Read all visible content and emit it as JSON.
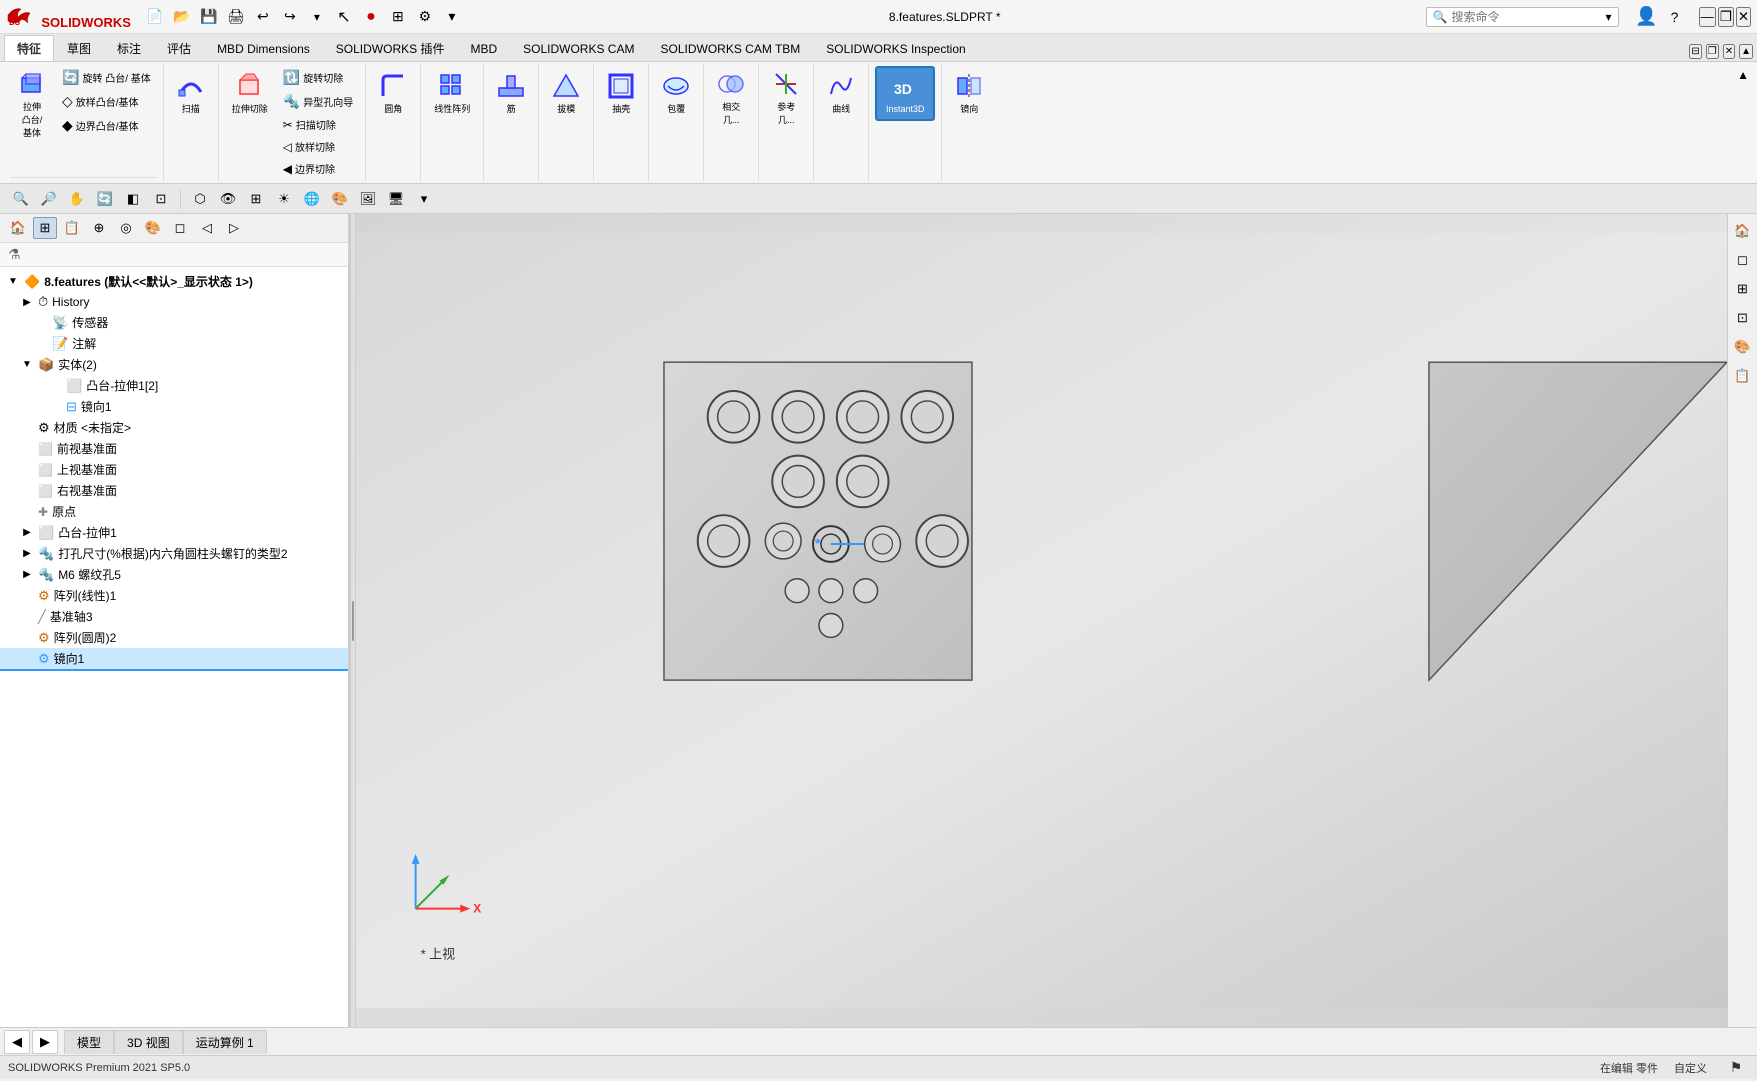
{
  "app": {
    "name": "SOLIDWORKS",
    "title": "8.features.SLDPRT *",
    "version": "SOLIDWORKS Premium 2021 SP5.0",
    "status_left": "在编辑 零件",
    "status_right": "自定义"
  },
  "titlebar": {
    "search_placeholder": "搜索命令",
    "win_min": "—",
    "win_restore": "❐",
    "win_close": "✕"
  },
  "ribbon_tabs": [
    {
      "label": "特征",
      "active": true
    },
    {
      "label": "草图"
    },
    {
      "label": "标注"
    },
    {
      "label": "评估"
    },
    {
      "label": "MBD Dimensions"
    },
    {
      "label": "SOLIDWORKS 插件"
    },
    {
      "label": "MBD"
    },
    {
      "label": "SOLIDWORKS CAM"
    },
    {
      "label": "SOLIDWORKS CAM TBM"
    },
    {
      "label": "SOLIDWORKS Inspection"
    }
  ],
  "ribbon_buttons": [
    {
      "label": "拉伸\n凸台/\n基体",
      "icon": "⬜"
    },
    {
      "label": "旋转\n凸台/\n基体",
      "icon": "🔄"
    },
    {
      "label": "放样凸台/基体",
      "icon": "📐"
    },
    {
      "label": "边界凸台/基体",
      "icon": "🔷"
    },
    {
      "label": "扫描",
      "icon": "〰"
    },
    {
      "label": "拉伸切除",
      "icon": "✂"
    },
    {
      "label": "旋转切除",
      "icon": "🔃"
    },
    {
      "label": "异型孔向导",
      "icon": "🔩"
    },
    {
      "label": "扫描切除",
      "icon": "✂"
    },
    {
      "label": "放样切除",
      "icon": "📐"
    },
    {
      "label": "边界切除",
      "icon": "🔶"
    },
    {
      "label": "圆角",
      "icon": "◟"
    },
    {
      "label": "线性阵列",
      "icon": "⠿"
    },
    {
      "label": "筋",
      "icon": "⊞"
    },
    {
      "label": "拔模",
      "icon": "◁"
    },
    {
      "label": "抽壳",
      "icon": "⬡"
    },
    {
      "label": "包覆",
      "icon": "🎁"
    },
    {
      "label": "相交\n几...",
      "icon": "⊗"
    },
    {
      "label": "参考\n几...",
      "icon": "📏"
    },
    {
      "label": "曲线",
      "icon": "〜"
    },
    {
      "label": "Instant3D",
      "icon": "3D",
      "highlighted": true
    },
    {
      "label": "镜向",
      "icon": "⊟"
    }
  ],
  "sidebar": {
    "tree_title": "8.features  (默认<<默认>_显示状态 1>)",
    "items": [
      {
        "id": "history",
        "label": "History",
        "icon": "⏱",
        "level": 1,
        "expandable": true
      },
      {
        "id": "sensor",
        "label": "传感器",
        "icon": "📡",
        "level": 1,
        "expandable": false
      },
      {
        "id": "annotation",
        "label": "注解",
        "icon": "📝",
        "level": 1,
        "expandable": false
      },
      {
        "id": "solid",
        "label": "实体(2)",
        "icon": "📦",
        "level": 1,
        "expandable": true
      },
      {
        "id": "boss1",
        "label": "凸台-拉伸1[2]",
        "icon": "⬜",
        "level": 2,
        "expandable": false
      },
      {
        "id": "mirror1-child",
        "label": "镜向1",
        "icon": "⊟",
        "level": 2,
        "expandable": false
      },
      {
        "id": "material",
        "label": "材质 <未指定>",
        "icon": "🔧",
        "level": 1,
        "expandable": false
      },
      {
        "id": "front-plane",
        "label": "前视基准面",
        "icon": "⬜",
        "level": 1,
        "expandable": false
      },
      {
        "id": "top-plane",
        "label": "上视基准面",
        "icon": "⬜",
        "level": 1,
        "expandable": false
      },
      {
        "id": "right-plane",
        "label": "右视基准面",
        "icon": "⬜",
        "level": 1,
        "expandable": false
      },
      {
        "id": "origin",
        "label": "原点",
        "icon": "✚",
        "level": 1,
        "expandable": false
      },
      {
        "id": "boss-extrude1",
        "label": "凸台-拉伸1",
        "icon": "⬜",
        "level": 1,
        "expandable": true
      },
      {
        "id": "hole-wizard",
        "label": "打孔尺寸(%根据)内六角圆柱头螺钉的类型2",
        "icon": "🔩",
        "level": 1,
        "expandable": true
      },
      {
        "id": "m6-hole",
        "label": "M6 螺纹孔5",
        "icon": "🔩",
        "level": 1,
        "expandable": true
      },
      {
        "id": "linear-pattern",
        "label": "阵列(线性)1",
        "icon": "⠿",
        "level": 1,
        "expandable": false
      },
      {
        "id": "ref-axis",
        "label": "基准轴3",
        "icon": "📏",
        "level": 1,
        "expandable": false
      },
      {
        "id": "circular-pattern",
        "label": "阵列(圆周)2",
        "icon": "⠿",
        "level": 1,
        "expandable": false
      },
      {
        "id": "mirror1",
        "label": "镜向1",
        "icon": "⊟",
        "level": 1,
        "expandable": false,
        "highlighted": true
      }
    ]
  },
  "bottom_tabs": [
    {
      "label": "模型",
      "active": false
    },
    {
      "label": "3D 视图",
      "active": false
    },
    {
      "label": "运动算例 1",
      "active": false
    }
  ],
  "view_label": "* 上视",
  "coord_label": "上视",
  "icons": {
    "solidworks_logo": "SW",
    "search_icon": "🔍",
    "filter_icon": "⚗",
    "expand_icon": "▶",
    "collapse_icon": "▼"
  }
}
